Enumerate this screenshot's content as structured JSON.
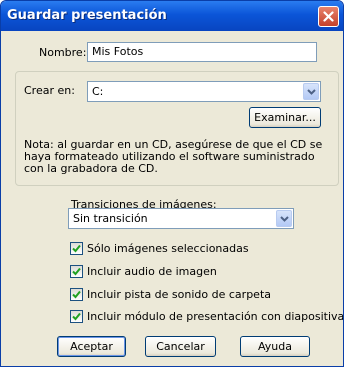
{
  "window": {
    "title": "Guardar presentación"
  },
  "name_field": {
    "label": "Nombre:",
    "value": "Mis Fotos"
  },
  "cd_group": {
    "label": "Crear en:",
    "drive_value": "C:",
    "browse_button": "Examinar...",
    "note": "Nota: al guardar en un CD, asegúrese de que el CD se haya formateado utilizando el software suministrado con la grabadora de CD."
  },
  "transitions": {
    "label": "Transiciones de imágenes:",
    "value": "Sin transición"
  },
  "options": [
    {
      "label": "Sólo imágenes seleccionadas",
      "checked": true
    },
    {
      "label": "Incluir audio de imagen",
      "checked": true
    },
    {
      "label": "Incluir pista de sonido de carpeta",
      "checked": true
    },
    {
      "label": "Incluir módulo de presentación con diapositivas",
      "checked": true
    }
  ],
  "buttons": {
    "accept": "Aceptar",
    "cancel": "Cancelar",
    "help": "Ayuda"
  },
  "colors": {
    "titlebar": "#0b55d8",
    "dialog_bg": "#ece9d8",
    "close_button": "#c4402a",
    "check_mark": "#21a121"
  },
  "icons": {
    "close": "close-icon",
    "dropdown": "chevron-down-icon",
    "check": "check-icon"
  }
}
